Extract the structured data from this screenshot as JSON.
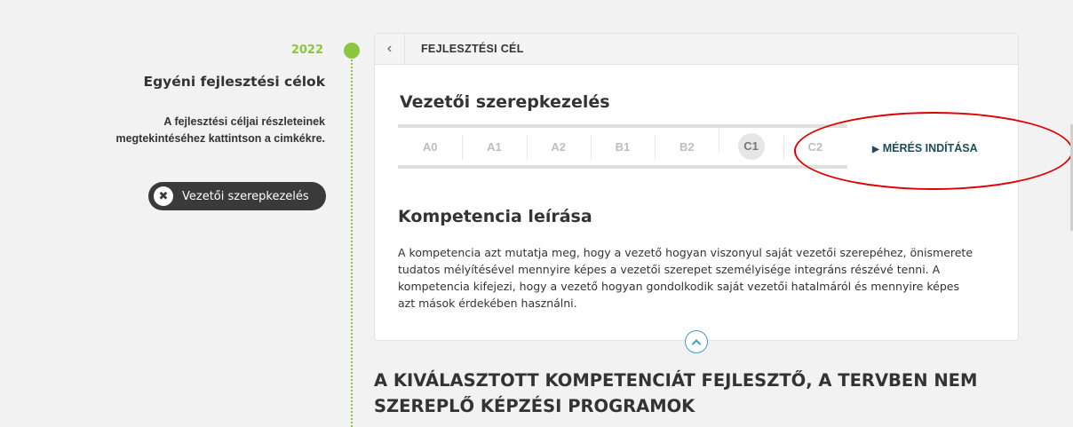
{
  "sidebar": {
    "year": "2022",
    "title": "Egyéni fejlesztési célok",
    "hint_line1": "A fejlesztési céljai részleteinek",
    "hint_line2": "megtekintéséhez kattintson a cimkékre.",
    "tag_label": "Vezetői szerepkezelés",
    "tag_remove_glyph": "✖"
  },
  "card": {
    "header_title": "FEJLESZTÉSI CÉL",
    "back_glyph": "‹",
    "competency_title": "Vezetői szerepkezelés",
    "levels": [
      "A0",
      "A1",
      "A2",
      "B1",
      "B2",
      "C1",
      "C2"
    ],
    "active_level": "C1",
    "start_button": "MÉRÉS INDÍTÁSA",
    "start_icon": "▶",
    "description_title": "Kompetencia leírása",
    "description_line1": "A kompetencia azt mutatja meg, hogy a vezető hogyan viszonyul saját vezetői szerepéhez, önismerete",
    "description_line2": "tudatos mélyítésével mennyire képes a vezetői szerepet személyisége integráns részévé tenni. A",
    "description_line3": "kompetencia kifejezi, hogy a vezető hogyan gondolkodik saját vezetői hatalmáról és mennyire képes",
    "description_line4": "azt mások érdekében használni.",
    "collapse_icon": "chevron-up-icon"
  },
  "programs": {
    "title_line1": "A KIVÁLASZTOTT KOMPETENCIÁT FEJLESZTŐ, A TERVBEN NEM",
    "title_line2": "SZEREPLŐ KÉPZÉSI PROGRAMOK"
  },
  "colors": {
    "accent_green": "#8cc63f",
    "dark_teal": "#1e4d57",
    "annotation_red": "#e00000",
    "chip_dark": "#3a3a3a",
    "collapse_blue": "#3aa0c8"
  }
}
